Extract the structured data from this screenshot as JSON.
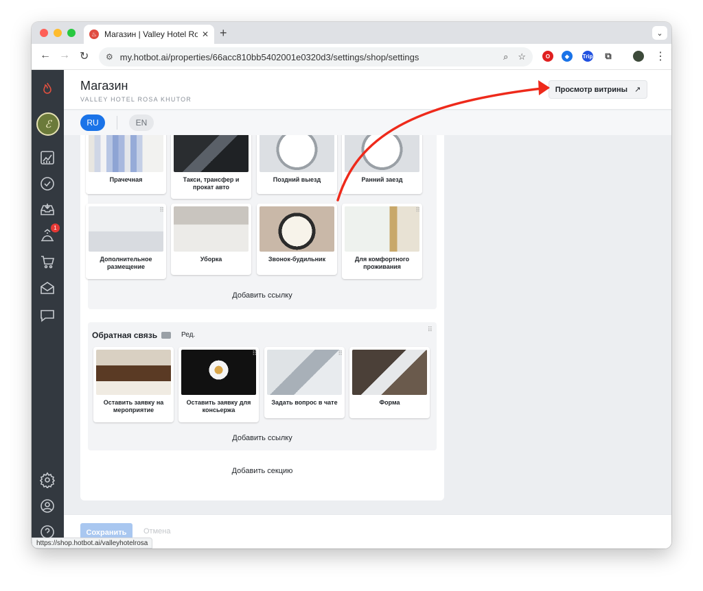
{
  "browser": {
    "tab_title": "Магазин | Valley Hotel Rosa K",
    "tab_favicon_color": "#e04b3f",
    "url": "my.hotbot.ai/properties/66acc810bb5402001e0320d3/settings/shop/settings",
    "status_url": "https://shop.hotbot.ai/valleyhotelrosa",
    "extensions": [
      {
        "name": "opera-extension-icon",
        "color": "#e02020"
      },
      {
        "name": "price-tag-extension-icon",
        "color": "#1a73e8"
      },
      {
        "name": "trip-extension-icon",
        "color": "#2050e0",
        "text": "Trip"
      },
      {
        "name": "puzzle-extensions-icon",
        "color": "#555555"
      }
    ]
  },
  "page": {
    "title": "Магазин",
    "subtitle": "VALLEY HOTEL ROSA KHUTOR",
    "preview_label": "Просмотр витрины",
    "preview_arrow": "↗"
  },
  "languages": {
    "active": "RU",
    "other": "EN"
  },
  "sidebar": {
    "badge_count": "1",
    "items": [
      "logo-flame-icon",
      "avatar",
      "analytics-icon",
      "tasks-check-icon",
      "inbox-download-icon",
      "room-service-icon",
      "cart-icon",
      "mail-icon",
      "chat-icon",
      "settings-gear-icon",
      "profile-icon",
      "help-icon"
    ]
  },
  "sections": [
    {
      "tiles": [
        {
          "label": "Прачечная",
          "img": "laundry"
        },
        {
          "label": "Такси, трансфер и прокат авто",
          "img": "taxi"
        },
        {
          "label": "Поздний выезд",
          "img": "clock"
        },
        {
          "label": "Ранний заезд",
          "img": "clock"
        },
        {
          "label": "Дополнительное размещение",
          "img": "sleep"
        },
        {
          "label": "Уборка",
          "img": "towel"
        },
        {
          "label": "Звонок-будильник",
          "img": "alarm"
        },
        {
          "label": "Для комфортного проживания",
          "img": "spa"
        }
      ],
      "add_link": "Добавить ссылку"
    },
    {
      "title": "Обратная связь",
      "edit_label": "Ред.",
      "tiles": [
        {
          "label": "Оставить заявку на мероприятие",
          "img": "hall"
        },
        {
          "label": "Оставить заявку для консьержа",
          "img": "concierge"
        },
        {
          "label": "Задать вопрос в чате",
          "img": "phone"
        },
        {
          "label": "Форма",
          "img": "phone2"
        }
      ],
      "add_link": "Добавить ссылку"
    }
  ],
  "add_section": "Добавить секцию",
  "footer": {
    "save": "Сохранить",
    "cancel": "Отмена"
  },
  "colors": {
    "accent": "#1a73e8",
    "annotation_arrow": "#ee2a1b"
  }
}
